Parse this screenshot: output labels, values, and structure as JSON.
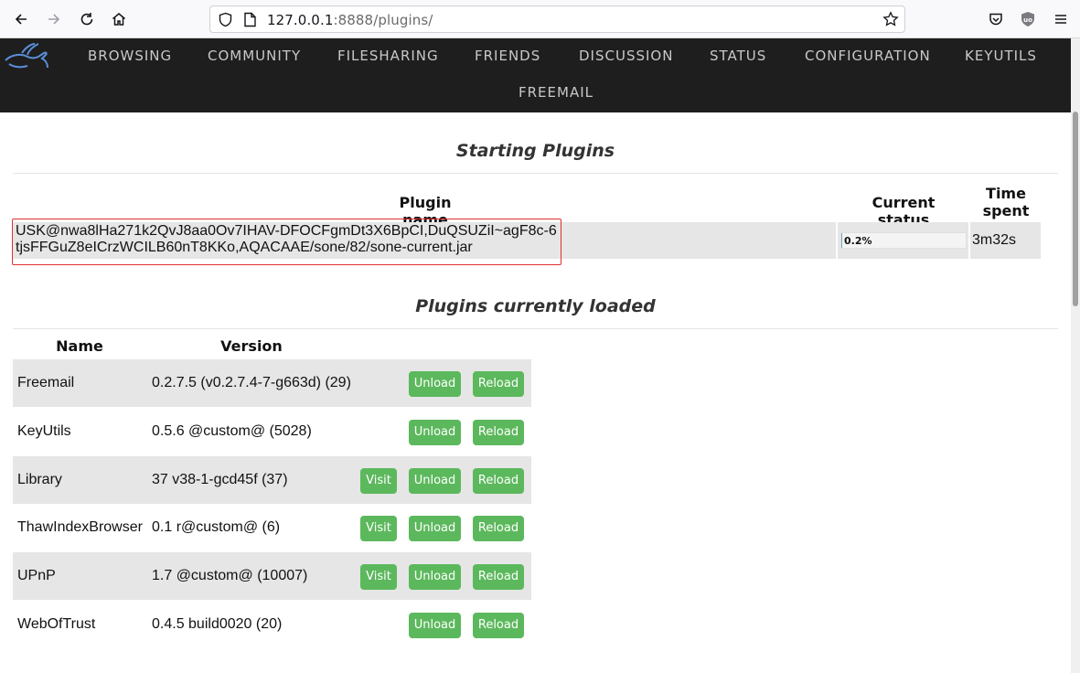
{
  "browser": {
    "url_host": "127.0.0.1",
    "url_rest": ":8888/plugins/"
  },
  "nav": {
    "items": [
      "BROWSING",
      "COMMUNITY",
      "FILESHARING",
      "FRIENDS",
      "DISCUSSION",
      "STATUS",
      "CONFIGURATION",
      "KEYUTILS"
    ],
    "second_row": "FREEMAIL"
  },
  "starting": {
    "title": "Starting Plugins",
    "headers": {
      "name": "Plugin name",
      "status": "Current status",
      "time": "Time spent"
    },
    "plugin": {
      "uri": "USK@nwa8lHa271k2QvJ8aa0Ov7IHAV-DFOCFgmDt3X6BpCI,DuQSUZiI~agF8c-6tjsFFGuZ8eICrzWCILB60nT8KKo,AQACAAE/sone/82/sone-current.jar",
      "status": "0.2%",
      "progress_fraction": 0.002,
      "time": "3m32s"
    }
  },
  "loaded": {
    "title": "Plugins currently loaded",
    "headers": {
      "name": "Name",
      "version": "Version"
    },
    "buttons": {
      "visit": "Visit",
      "unload": "Unload",
      "reload": "Reload"
    },
    "rows": [
      {
        "name": "Freemail",
        "version": "0.2.7.5 (v0.2.7.4-7-g663d) (29)"
      },
      {
        "name": "KeyUtils",
        "version": "0.5.6 @custom@ (5028)"
      },
      {
        "name": "Library",
        "version": "37 v38-1-gcd45f (37)"
      },
      {
        "name": "ThawIndexBrowser",
        "version": "0.1 r@custom@ (6)"
      },
      {
        "name": "UPnP",
        "version": "1.7 @custom@ (10007)"
      },
      {
        "name": "WebOfTrust",
        "version": "0.4.5 build0020 (20)"
      }
    ]
  },
  "colors": {
    "nav_bg": "#1e1e1e",
    "button_green": "#5cb85c",
    "highlight_red": "#e03030"
  }
}
